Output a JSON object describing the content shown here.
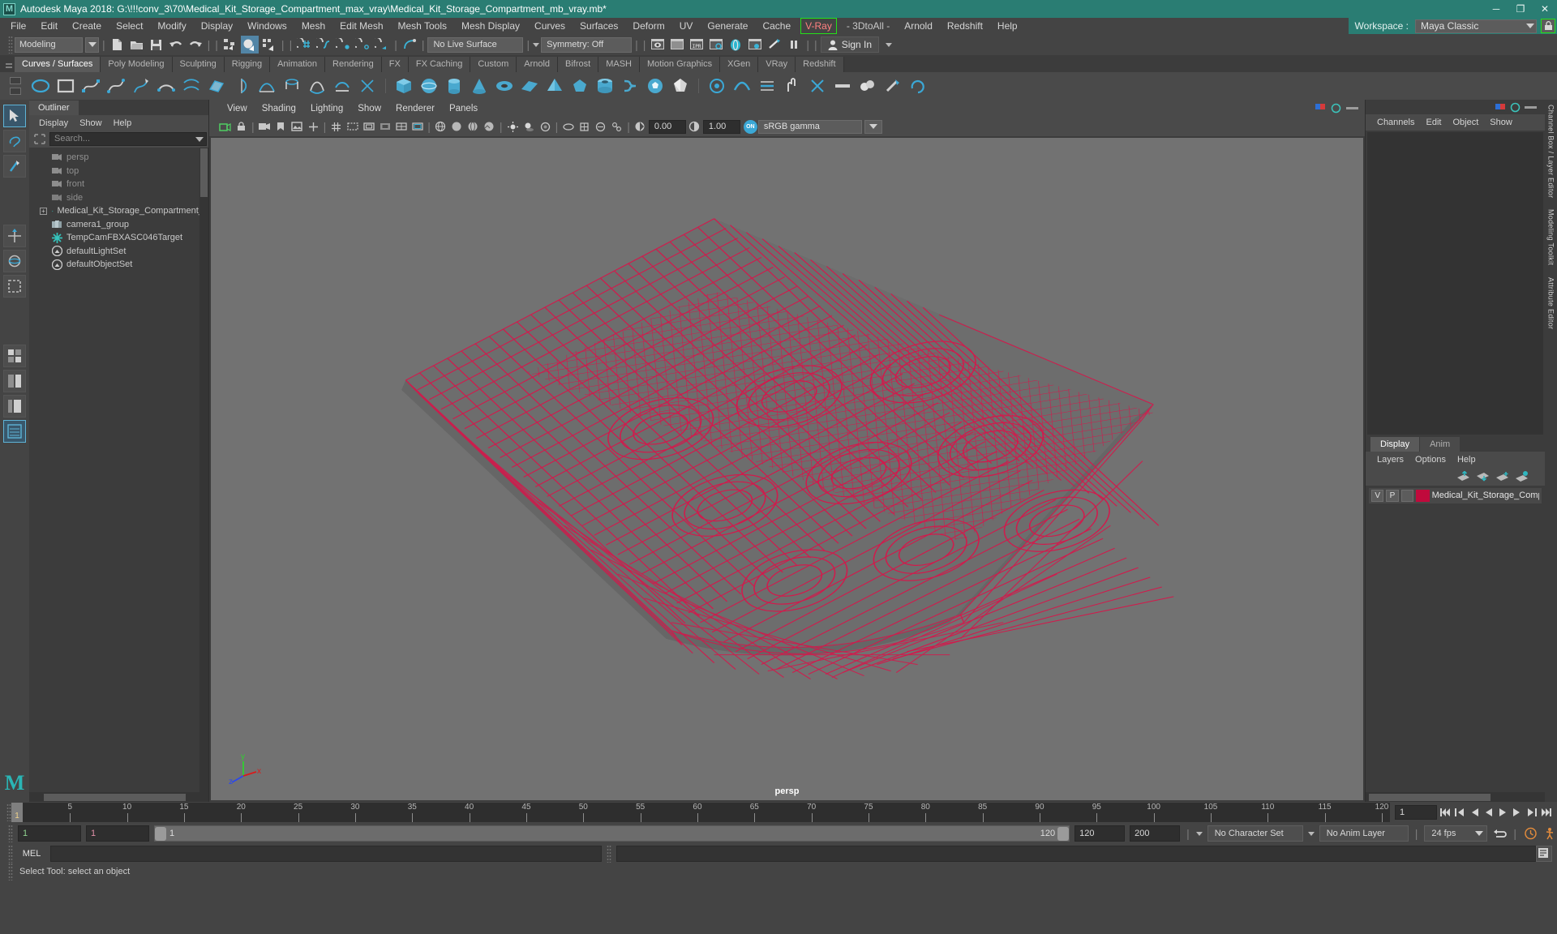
{
  "titlebar": {
    "app_icon": "maya-logo-icon",
    "title": "Autodesk Maya 2018: G:\\!!!conv_3\\70\\Medical_Kit_Storage_Compartment_max_vray\\Medical_Kit_Storage_Compartment_mb_vray.mb*",
    "minimize": "─",
    "maximize": "❐",
    "close": "✕",
    "bg": "#2a7d73"
  },
  "menubar": {
    "items": [
      "File",
      "Edit",
      "Create",
      "Select",
      "Modify",
      "Display",
      "Windows",
      "Mesh",
      "Edit Mesh",
      "Mesh Tools",
      "Mesh Display",
      "Curves",
      "Surfaces",
      "Deform",
      "UV",
      "Generate",
      "Cache"
    ],
    "vray": "V-Ray",
    "after_vray": [
      "- 3DtoAll -",
      "Arnold",
      "Redshift",
      "Help"
    ],
    "vray_border": "#25e019",
    "vray_text": "#ff8080",
    "workspace_label": "Workspace :",
    "workspace_value": "Maya Classic",
    "lock_icon": "lock-icon"
  },
  "statusline": {
    "mode": "Modeling",
    "live_surface": "No Live Surface",
    "symmetry": "Symmetry: Off",
    "sign_in": "Sign In",
    "icons": [
      "new-scene-icon",
      "open-scene-icon",
      "save-scene-icon",
      "undo-icon",
      "redo-icon",
      "select-hierarchy-icon",
      "select-object-icon",
      "select-component-icon",
      "snap-grid-icon",
      "snap-curve-icon",
      "snap-point-icon",
      "snap-projected-icon",
      "snap-view-plane-icon",
      "construction-history-icon",
      "render-current-frame-icon",
      "render-sequence-icon",
      "ipr-render-icon",
      "render-settings-icon",
      "hypershade-icon",
      "render-view-icon",
      "render-setup-icon",
      "pause-render-icon",
      "show-editor-icon",
      "show-attribute-icon",
      "show-tool-icon",
      "show-channel-box-icon",
      "show-layer-icon"
    ]
  },
  "shelf": {
    "tabs": [
      "Curves / Surfaces",
      "Poly Modeling",
      "Sculpting",
      "Rigging",
      "Animation",
      "Rendering",
      "FX",
      "FX Caching",
      "Custom",
      "Arnold",
      "Bifrost",
      "MASH",
      "Motion Graphics",
      "XGen",
      "VRay",
      "Redshift"
    ],
    "active_tab": "Curves / Surfaces",
    "icon_accent": "#3ba8d6"
  },
  "toolbox": {
    "tools": [
      "select-tool-icon",
      "lasso-select-tool-icon",
      "paint-select-tool-icon",
      "move-tool-icon",
      "rotate-tool-icon",
      "scale-tool-icon",
      "last-tool-icon",
      "four-view-layout-icon",
      "two-pane-layout-icon",
      "persp-outliner-layout-icon",
      "single-perspective-layout-icon"
    ],
    "selected_tool": "select-tool-icon",
    "watermark": "M"
  },
  "outliner": {
    "tab": "Outliner",
    "menus": [
      "Display",
      "Show",
      "Help"
    ],
    "search_placeholder": "Search...",
    "search_value": "",
    "filter_icon": "filter-icon",
    "items": [
      {
        "label": "persp",
        "icon": "camera-icon",
        "dim": true,
        "expandable": false
      },
      {
        "label": "top",
        "icon": "camera-icon",
        "dim": true,
        "expandable": false
      },
      {
        "label": "front",
        "icon": "camera-icon",
        "dim": true,
        "expandable": false
      },
      {
        "label": "side",
        "icon": "camera-icon",
        "dim": true,
        "expandable": false
      },
      {
        "label": "Medical_Kit_Storage_Compartment_n",
        "icon": "transform-icon",
        "dim": false,
        "expandable": true
      },
      {
        "label": "camera1_group",
        "icon": "group-icon",
        "dim": false,
        "expandable": false
      },
      {
        "label": "TempCamFBXASC046Target",
        "icon": "transform-icon",
        "dim": false,
        "expandable": false
      },
      {
        "label": "defaultLightSet",
        "icon": "set-icon",
        "dim": false,
        "expandable": false
      },
      {
        "label": "defaultObjectSet",
        "icon": "set-icon",
        "dim": false,
        "expandable": false
      }
    ]
  },
  "viewport": {
    "menus": [
      "View",
      "Shading",
      "Lighting",
      "Show",
      "Renderer",
      "Panels"
    ],
    "exposure": "0.00",
    "gamma_value": "1.00",
    "color_management": "sRGB gamma",
    "cm_toggle": "ON",
    "camera_label": "persp",
    "background": "#727272",
    "wireframe_color": "#d6174b",
    "axis": {
      "x": "x",
      "y": "y",
      "z": "z",
      "x_color": "#d81b1b",
      "y_color": "#2fd02f",
      "z_color": "#2a47ee"
    },
    "toolbar_icons": [
      "select-camera-icon",
      "lock-camera-icon",
      "camera-attributes-icon",
      "bookmark-icon",
      "image-plane-icon",
      "two-d-pan-zoom-icon",
      "grid-icon",
      "film-gate-icon",
      "resolution-gate-icon",
      "gate-mask-icon",
      "field-chart-icon",
      "safe-action-icon",
      "safe-title-icon",
      "wireframe-icon",
      "smooth-shade-icon",
      "shaded-wireframe-icon",
      "textured-icon",
      "use-all-lights-icon",
      "shadows-icon",
      "screen-space-ao-icon",
      "motion-blur-icon",
      "multisample-icon",
      "depth-peeling-icon",
      "xray-icon",
      "xray-joints-icon",
      "exposure-icon",
      "gamma-icon"
    ]
  },
  "channelbox": {
    "menus": [
      "Channels",
      "Edit",
      "Object",
      "Show"
    ],
    "vertical_tabs": [
      "Channel Box / Layer Editor",
      "Modeling Toolkit",
      "Attribute Editor"
    ],
    "rows": []
  },
  "layereditor": {
    "tabs": [
      "Display",
      "Anim"
    ],
    "active_tab": "Display",
    "menus": [
      "Layers",
      "Options",
      "Help"
    ],
    "buttons": [
      "move-layer-up-icon",
      "move-layer-down-icon",
      "new-layer-icon",
      "new-layer-from-selected-icon"
    ],
    "layers": [
      {
        "visibility": "V",
        "playback": "P",
        "type": "",
        "color": "#c00a3c",
        "name": "Medical_Kit_Storage_Compartm"
      }
    ]
  },
  "timeslider": {
    "current_frame": "1",
    "ticks": [
      5,
      10,
      15,
      20,
      25,
      30,
      35,
      40,
      45,
      50,
      55,
      60,
      65,
      70,
      75,
      80,
      85,
      90,
      95,
      100,
      105,
      110,
      115,
      120
    ],
    "start": 1,
    "end": 120,
    "playback_field": "1",
    "controls": [
      "go-to-start-icon",
      "step-back-key-icon",
      "step-back-frame-icon",
      "play-backwards-icon",
      "play-forwards-icon",
      "step-forward-frame-icon",
      "step-forward-key-icon",
      "go-to-end-icon"
    ]
  },
  "rangeslider": {
    "anim_start": "1",
    "range_start": "1",
    "slider_min_label": "1",
    "slider_max_label": "120",
    "range_end": "120",
    "anim_end": "200",
    "character_set": "No Character Set",
    "anim_layer": "No Anim Layer",
    "fps": "24 fps",
    "auto_key_icon": "auto-key-icon",
    "anim_prefs_icon": "animation-preferences-icon",
    "cycle_icon": "playback-loop-icon"
  },
  "commandline": {
    "language": "MEL",
    "input_value": "",
    "output_value": "",
    "script_editor_icon": "script-editor-icon"
  },
  "helpline": {
    "text": "Select Tool: select an object"
  }
}
